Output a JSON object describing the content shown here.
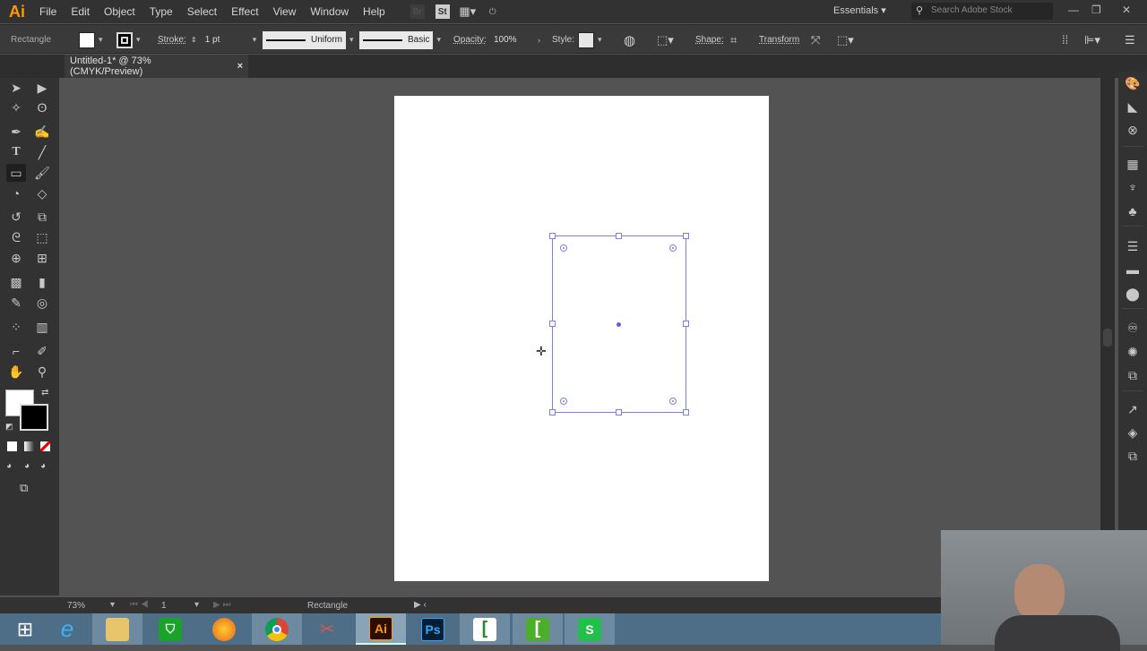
{
  "app": {
    "logo": "Ai",
    "menus": [
      "File",
      "Edit",
      "Object",
      "Type",
      "Select",
      "Effect",
      "View",
      "Window",
      "Help"
    ],
    "workspace": "Essentials",
    "search_placeholder": "Search Adobe Stock",
    "bridge_icon": "Br",
    "stock_icon": "St"
  },
  "control_bar": {
    "tool_name": "Rectangle",
    "stroke_label": "Stroke:",
    "stroke_weight": "1 pt",
    "profile": "Uniform",
    "brush": "Basic",
    "opacity_label": "Opacity:",
    "opacity": "100%",
    "style_label": "Style:",
    "shape_label": "Shape:",
    "transform_label": "Transform"
  },
  "document": {
    "tab_title": "Untitled-1* @ 73% (CMYK/Preview)",
    "close": "×"
  },
  "status": {
    "zoom": "73%",
    "artboard": "1",
    "current_tool": "Rectangle"
  },
  "taskbar": {
    "apps": [
      "start",
      "internet-explorer",
      "file-explorer",
      "store",
      "firefox",
      "chrome",
      "snipping-tool",
      "illustrator",
      "photoshop",
      "camtasia-recorder",
      "camtasia-studio",
      "spreadsheet"
    ],
    "ai_label": "Ai",
    "ps_label": "Ps"
  },
  "colors": {
    "selection": "#7b7fe3",
    "accent": "#ff9a00"
  }
}
